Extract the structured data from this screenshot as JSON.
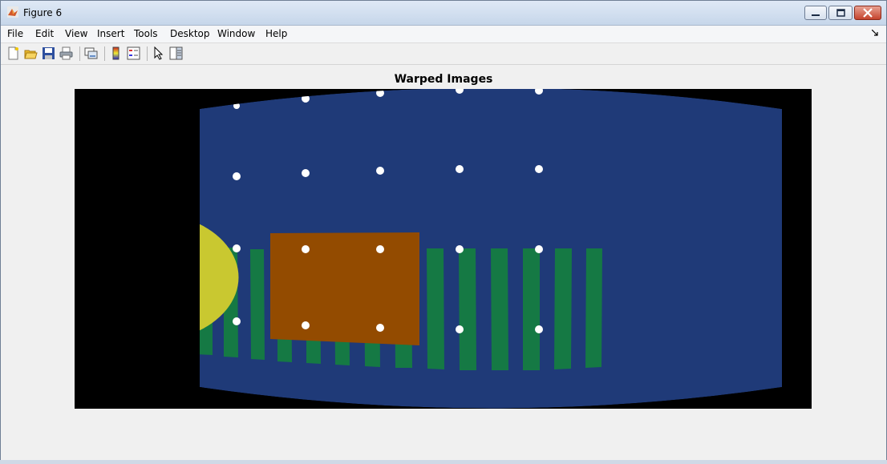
{
  "window": {
    "title": "Figure 6"
  },
  "menu": {
    "items": [
      "File",
      "Edit",
      "View",
      "Insert",
      "Tools",
      "Desktop",
      "Window",
      "Help"
    ]
  },
  "figure": {
    "title": "Warped Images"
  },
  "icons": {
    "app": "matlab-icon",
    "toolbar": [
      "new-figure-icon",
      "open-file-icon",
      "save-icon",
      "print-icon",
      "link-plot-icon",
      "colorbar-icon",
      "legend-icon",
      "pointer-icon",
      "property-inspector-icon"
    ]
  },
  "colors": {
    "background": "#000000",
    "canvas": "#1f3a78",
    "circle": "#c9c830",
    "rectangle": "#934b00",
    "bars": "#157944",
    "dots": "#ffffff"
  }
}
